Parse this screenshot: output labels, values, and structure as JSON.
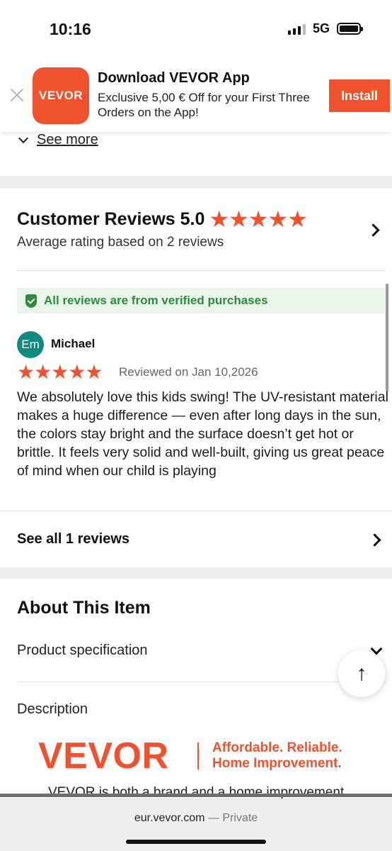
{
  "status_bar": {
    "time": "10:16",
    "network": "5G"
  },
  "app_banner": {
    "logo_text": "VEVOR",
    "title": "Download VEVOR App",
    "subtitle": "Exclusive 5,00 € Off for your First Three Orders on the App!",
    "install_label": "Install"
  },
  "see_more_label": "See more",
  "reviews": {
    "title": "Customer Reviews 5.0",
    "rating_stars": "★★★★★",
    "subtitle": "Average rating based on 2 reviews",
    "verified_text": "All reviews are from verified purchases",
    "items": [
      {
        "avatar_initials": "Em",
        "name": "Michael",
        "stars": "★★★★★",
        "date": "Reviewed on Jan 10,2026",
        "text": "We absolutely love this kids swing! The UV-resistant material makes a huge difference — even after long days in the sun, the colors stay bright and the surface doesn’t get hot or brittle. It feels very solid and well-built, giving us great peace of mind when our child is playing"
      }
    ],
    "see_all_label": "See all 1 reviews"
  },
  "about": {
    "title": "About This Item",
    "spec_label": "Product specification",
    "description_label": "Description",
    "brand_logo": "VEVOR",
    "tagline_line1": "Affordable. Reliable.",
    "tagline_line2": "Home Improvement.",
    "brand_text": "VEVOR is both a brand and a home improvement"
  },
  "browser": {
    "url": "eur.vevor.com",
    "separator": "—",
    "mode": "Private"
  },
  "colors": {
    "brand": "#f0522d",
    "verified_green": "#2e8b3c",
    "avatar_teal": "#0e8a7e"
  },
  "icons": [
    "close-icon",
    "chevron-down-icon",
    "chevron-right-icon",
    "shield-check-icon",
    "arrow-up-icon",
    "star-icon"
  ]
}
